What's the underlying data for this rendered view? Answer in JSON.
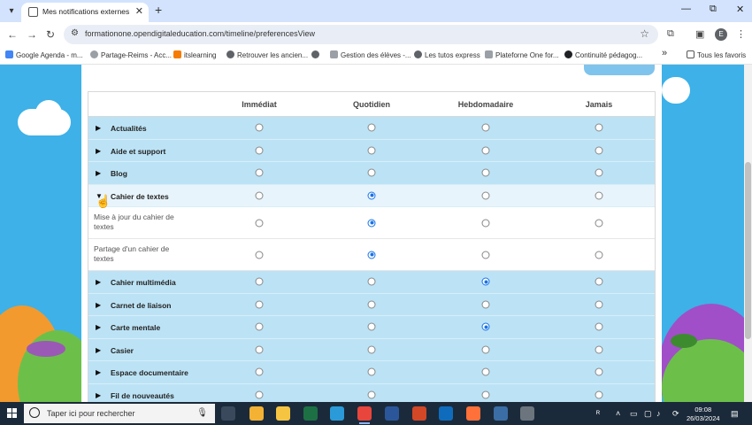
{
  "browser": {
    "tab_title": "Mes notifications externes",
    "tab_close": "✕",
    "new_tab": "+",
    "url": "formationone.opendigitaleducation.com/timeline/preferencesView",
    "profile_initial": "E",
    "window_controls": {
      "minimize": "—",
      "restore": "⧉",
      "close": "✕"
    }
  },
  "bookmarks": [
    {
      "label": "Google Agenda - m...",
      "color": "#4285f4"
    },
    {
      "label": "Partage-Reims - Acc...",
      "color": "#9aa0a6"
    },
    {
      "label": "itslearning",
      "color": "#f57c00"
    },
    {
      "label": "Retrouver les ancien...",
      "color": "#5f6368"
    },
    {
      "label": "",
      "color": "#5f6368"
    },
    {
      "label": "Gestion des élèves -...",
      "color": "#9aa0a6"
    },
    {
      "label": "Les tutos express",
      "color": "#5f6368"
    },
    {
      "label": "Plateforne One for...",
      "color": "#9aa0a6"
    },
    {
      "label": "Continuité pédagog...",
      "color": "#202124"
    }
  ],
  "bookmarks_more": "»",
  "bookmarks_all": "Tous les favoris",
  "table": {
    "columns": [
      "Immédiat",
      "Quotidien",
      "Hebdomadaire",
      "Jamais"
    ],
    "rows": [
      {
        "label": "Actualités",
        "type": "app",
        "expanded": false,
        "selected": -1
      },
      {
        "label": "Aide et support",
        "type": "app",
        "expanded": false,
        "selected": -1
      },
      {
        "label": "Blog",
        "type": "app",
        "expanded": false,
        "selected": -1
      },
      {
        "label": "Cahier de textes",
        "type": "app",
        "expanded": true,
        "selected": 1
      },
      {
        "label": "Mise à jour du cahier de textes",
        "type": "sub",
        "selected": 1
      },
      {
        "label": "Partage d'un cahier de textes",
        "type": "sub",
        "selected": 1
      },
      {
        "label": "Cahier multimédia",
        "type": "app",
        "expanded": false,
        "selected": 2
      },
      {
        "label": "Carnet de liaison",
        "type": "app",
        "expanded": false,
        "selected": -1
      },
      {
        "label": "Carte mentale",
        "type": "app",
        "expanded": false,
        "selected": 2
      },
      {
        "label": "Casier",
        "type": "app",
        "expanded": false,
        "selected": -1
      },
      {
        "label": "Espace documentaire",
        "type": "app",
        "expanded": false,
        "selected": -1
      },
      {
        "label": "Fil de nouveautés",
        "type": "app",
        "expanded": false,
        "selected": -1
      }
    ]
  },
  "taskbar": {
    "search_placeholder": "Taper ici pour rechercher",
    "time": "09:08",
    "date": "26/03/2024",
    "apps": [
      {
        "name": "task-view",
        "color": "#3a4a5c"
      },
      {
        "name": "store",
        "color": "#f3b233"
      },
      {
        "name": "file-explorer",
        "color": "#f5c542"
      },
      {
        "name": "excel",
        "color": "#1d7044"
      },
      {
        "name": "edge",
        "color": "#2a9bd8"
      },
      {
        "name": "chrome",
        "color": "#e8453c"
      },
      {
        "name": "word",
        "color": "#2b579a"
      },
      {
        "name": "powerpoint",
        "color": "#d24726"
      },
      {
        "name": "mail",
        "color": "#0f6cbd"
      },
      {
        "name": "firefox",
        "color": "#ff7139"
      },
      {
        "name": "app-blue",
        "color": "#3b6ea5"
      },
      {
        "name": "app-clock",
        "color": "#6c757d"
      }
    ]
  }
}
